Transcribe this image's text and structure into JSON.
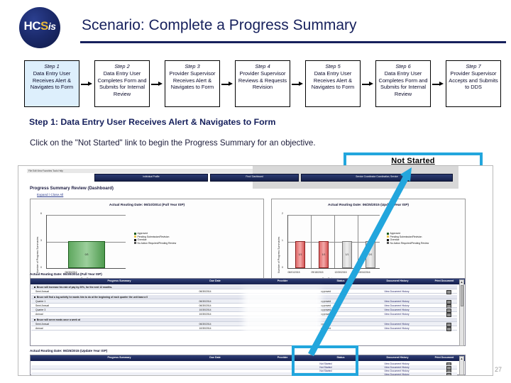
{
  "header": {
    "logo_h": "HC",
    "logo_c": "S",
    "logo_is": "is",
    "title": "Scenario: Complete a Progress Summary"
  },
  "steps": [
    {
      "title": "Step 1",
      "body": "Data Entry User Receives Alert & Navigates to Form",
      "active": true
    },
    {
      "title": "Step 2",
      "body": "Data Entry User Completes Form and Submits for Internal Review",
      "active": false
    },
    {
      "title": "Step 3",
      "body": "Provider Supervisor Receives Alert & Navigates to Form",
      "active": false
    },
    {
      "title": "Step 4",
      "body": "Provider Supervisor Reviews & Requests Revision",
      "active": false
    },
    {
      "title": "Step 5",
      "body": "Data Entry User Receives Alert & Navigates to Form",
      "active": false
    },
    {
      "title": "Step 6",
      "body": "Data Entry User Completes Form and Submits for Internal Review",
      "active": false
    },
    {
      "title": "Step 7",
      "body": "Provider Supervisor Accepts and Submits to DDS",
      "active": false
    }
  ],
  "content": {
    "step_heading": "Step 1: Data Entry User Receives Alert & Navigates to Form",
    "instruction": "Click on the \"Not Started\" link to begin the Progress Summary for an objective.",
    "callout_label": "Not Started"
  },
  "screenshot": {
    "menubar": "File   Edit   View   Favorites   Tools   Help",
    "nav_tabs": [
      "Individual Profile",
      "Find / Dashboard",
      "Service Coordinator Coordination, Service"
    ],
    "page_heading": "Progress Summary Review (Dashboard)",
    "page_sublink": "Expand / Close All",
    "chart_left": {
      "title": "Actual Routing Date: 06/10/2014 (Full Year ISP)",
      "ylabel": "Number of Progress Summaries",
      "xlabel": "Due Dates",
      "categories": [
        "06/30/2014"
      ],
      "values": [
        3
      ],
      "yticks": [
        "0",
        "3",
        "6"
      ],
      "bar_label": "0/3",
      "bar_color": "#5fa85f"
    },
    "chart_right": {
      "title": "Actual Routing Date: 06/25/2015 (Update Year ISP)",
      "ylabel": "Number of Progress Summaries",
      "xlabel": "Due Dates",
      "categories": [
        "06/01/2015",
        "09/18/2015",
        "12/30/2015",
        "03/04/2016"
      ],
      "values": [
        1,
        1,
        1,
        1
      ],
      "yticks": [
        "0",
        "1",
        "2"
      ],
      "bar_labels": [
        "1/1",
        "1/1",
        "1/1",
        "0/1"
      ],
      "bar_colors": [
        "#e06a6a",
        "#e06a6a",
        "#d0d0d0",
        "#d0d0d0"
      ]
    },
    "legend": [
      {
        "label": "Approved",
        "color": "#1b5c1b"
      },
      {
        "label": "Pending Submission/Revision",
        "color": "#e8c44a"
      },
      {
        "label": "Overdue",
        "color": "#111111"
      },
      {
        "label": "No Action Required/Pending Review",
        "color": "#555555"
      }
    ],
    "table_top": {
      "caption": "Actual Routing Date: 06/30/2014 (Full Year ISP)",
      "columns": [
        "Progress Summary",
        "Due Date",
        "Provider",
        "Status",
        "Document History",
        "Print Document"
      ],
      "groups": [
        {
          "objective": "Bruce will increase his rate of pay by 20%, for the next 12 months.",
          "rows": [
            {
              "period": "Semi Annual",
              "due": "06/30/2014",
              "status": "approved",
              "history": "View Document History"
            }
          ]
        },
        {
          "objective": "Bruce will find a log activity he wants him to do at the beginning of each quarter the unit base a 0",
          "rows": [
            {
              "period": "Quarter 1",
              "due": "06/30/2014",
              "status": "approved",
              "history": "View Document History"
            },
            {
              "period": "Semi Annual",
              "due": "06/30/2014",
              "status": "approved",
              "history": "View Document History"
            },
            {
              "period": "Quarter 3",
              "due": "10/30/2014",
              "status": "approved",
              "history": "View Document History"
            },
            {
              "period": "Annual",
              "due": "10/30/2014",
              "status": "approved",
              "history": "View Document History"
            }
          ]
        },
        {
          "objective": "Bruce will serve meals once a week at",
          "rows": [
            {
              "period": "Semi Annual",
              "due": "06/30/2014",
              "status": "approved",
              "history": "View Document History"
            },
            {
              "period": "Annual",
              "due": "10/30/2014",
              "status": "approved",
              "history": "View Document History"
            }
          ]
        }
      ]
    },
    "table_bottom": {
      "caption": "Actual Routing Date: 06/25/2015 (Update Year ISP)",
      "columns": [
        "Progress Summary",
        "Due Date",
        "Provider",
        "Status",
        "Document History",
        "Print Document"
      ],
      "rows": [
        {
          "status": "Not Started",
          "history": "View Document History"
        },
        {
          "status": "Not Started",
          "history": "View Document History"
        },
        {
          "status": "Not Started",
          "history": "View Document History"
        },
        {
          "status": "Not Started",
          "history": "View Document History"
        }
      ]
    }
  },
  "footer": {
    "page_number": "27"
  },
  "colors": {
    "accent_cyan": "#22a6dd",
    "navy": "#16205c"
  }
}
